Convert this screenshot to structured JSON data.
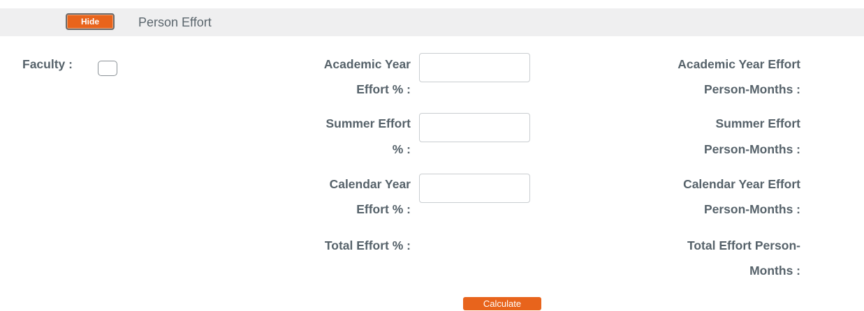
{
  "header": {
    "hide_label": "Hide",
    "title": "Person Effort"
  },
  "form": {
    "faculty_label": "Faculty :",
    "academic_effort_label_1": "Academic Year",
    "academic_effort_label_2": "Effort % :",
    "summer_effort_label_1": "Summer Effort",
    "summer_effort_label_2": "% :",
    "calendar_effort_label_1": "Calendar Year",
    "calendar_effort_label_2": "Effort % :",
    "total_effort_label": "Total Effort % :",
    "academic_pm_label_1": "Academic Year Effort",
    "academic_pm_label_2": "Person-Months :",
    "summer_pm_label_1": "Summer Effort",
    "summer_pm_label_2": "Person-Months :",
    "calendar_pm_label_1": "Calendar Year Effort",
    "calendar_pm_label_2": "Person-Months :",
    "total_pm_label_1": "Total Effort Person-",
    "total_pm_label_2": "Months :",
    "academic_effort_value": "",
    "summer_effort_value": "",
    "calendar_effort_value": ""
  },
  "actions": {
    "calculate_label": "Calculate"
  },
  "colors": {
    "accent": "#e8641c",
    "header_bg": "#efeff0",
    "label_text": "#56626a"
  }
}
